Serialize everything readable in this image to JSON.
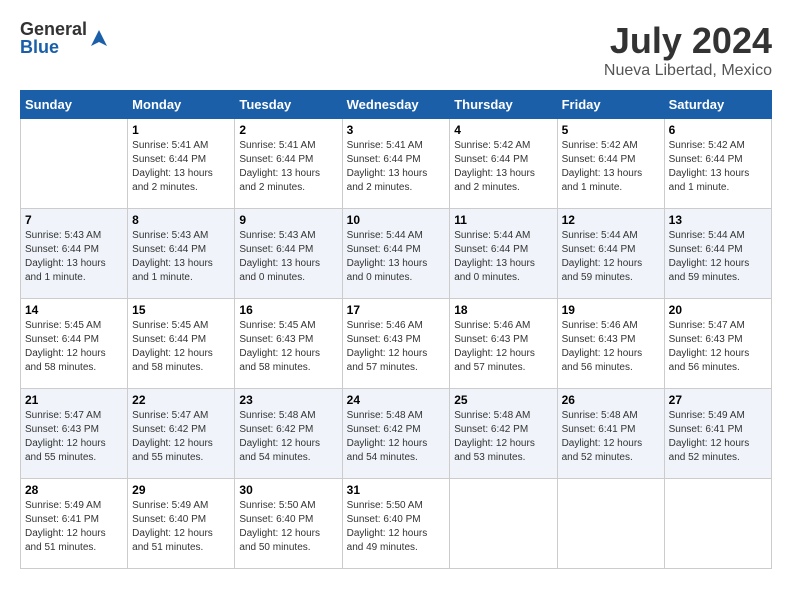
{
  "logo": {
    "general": "General",
    "blue": "Blue"
  },
  "title": "July 2024",
  "subtitle": "Nueva Libertad, Mexico",
  "days_of_week": [
    "Sunday",
    "Monday",
    "Tuesday",
    "Wednesday",
    "Thursday",
    "Friday",
    "Saturday"
  ],
  "weeks": [
    [
      {
        "day": "",
        "sunrise": "",
        "sunset": "",
        "daylight": ""
      },
      {
        "day": "1",
        "sunrise": "Sunrise: 5:41 AM",
        "sunset": "Sunset: 6:44 PM",
        "daylight": "Daylight: 13 hours and 2 minutes."
      },
      {
        "day": "2",
        "sunrise": "Sunrise: 5:41 AM",
        "sunset": "Sunset: 6:44 PM",
        "daylight": "Daylight: 13 hours and 2 minutes."
      },
      {
        "day": "3",
        "sunrise": "Sunrise: 5:41 AM",
        "sunset": "Sunset: 6:44 PM",
        "daylight": "Daylight: 13 hours and 2 minutes."
      },
      {
        "day": "4",
        "sunrise": "Sunrise: 5:42 AM",
        "sunset": "Sunset: 6:44 PM",
        "daylight": "Daylight: 13 hours and 2 minutes."
      },
      {
        "day": "5",
        "sunrise": "Sunrise: 5:42 AM",
        "sunset": "Sunset: 6:44 PM",
        "daylight": "Daylight: 13 hours and 1 minute."
      },
      {
        "day": "6",
        "sunrise": "Sunrise: 5:42 AM",
        "sunset": "Sunset: 6:44 PM",
        "daylight": "Daylight: 13 hours and 1 minute."
      }
    ],
    [
      {
        "day": "7",
        "sunrise": "Sunrise: 5:43 AM",
        "sunset": "Sunset: 6:44 PM",
        "daylight": "Daylight: 13 hours and 1 minute."
      },
      {
        "day": "8",
        "sunrise": "Sunrise: 5:43 AM",
        "sunset": "Sunset: 6:44 PM",
        "daylight": "Daylight: 13 hours and 1 minute."
      },
      {
        "day": "9",
        "sunrise": "Sunrise: 5:43 AM",
        "sunset": "Sunset: 6:44 PM",
        "daylight": "Daylight: 13 hours and 0 minutes."
      },
      {
        "day": "10",
        "sunrise": "Sunrise: 5:44 AM",
        "sunset": "Sunset: 6:44 PM",
        "daylight": "Daylight: 13 hours and 0 minutes."
      },
      {
        "day": "11",
        "sunrise": "Sunrise: 5:44 AM",
        "sunset": "Sunset: 6:44 PM",
        "daylight": "Daylight: 13 hours and 0 minutes."
      },
      {
        "day": "12",
        "sunrise": "Sunrise: 5:44 AM",
        "sunset": "Sunset: 6:44 PM",
        "daylight": "Daylight: 12 hours and 59 minutes."
      },
      {
        "day": "13",
        "sunrise": "Sunrise: 5:44 AM",
        "sunset": "Sunset: 6:44 PM",
        "daylight": "Daylight: 12 hours and 59 minutes."
      }
    ],
    [
      {
        "day": "14",
        "sunrise": "Sunrise: 5:45 AM",
        "sunset": "Sunset: 6:44 PM",
        "daylight": "Daylight: 12 hours and 58 minutes."
      },
      {
        "day": "15",
        "sunrise": "Sunrise: 5:45 AM",
        "sunset": "Sunset: 6:44 PM",
        "daylight": "Daylight: 12 hours and 58 minutes."
      },
      {
        "day": "16",
        "sunrise": "Sunrise: 5:45 AM",
        "sunset": "Sunset: 6:43 PM",
        "daylight": "Daylight: 12 hours and 58 minutes."
      },
      {
        "day": "17",
        "sunrise": "Sunrise: 5:46 AM",
        "sunset": "Sunset: 6:43 PM",
        "daylight": "Daylight: 12 hours and 57 minutes."
      },
      {
        "day": "18",
        "sunrise": "Sunrise: 5:46 AM",
        "sunset": "Sunset: 6:43 PM",
        "daylight": "Daylight: 12 hours and 57 minutes."
      },
      {
        "day": "19",
        "sunrise": "Sunrise: 5:46 AM",
        "sunset": "Sunset: 6:43 PM",
        "daylight": "Daylight: 12 hours and 56 minutes."
      },
      {
        "day": "20",
        "sunrise": "Sunrise: 5:47 AM",
        "sunset": "Sunset: 6:43 PM",
        "daylight": "Daylight: 12 hours and 56 minutes."
      }
    ],
    [
      {
        "day": "21",
        "sunrise": "Sunrise: 5:47 AM",
        "sunset": "Sunset: 6:43 PM",
        "daylight": "Daylight: 12 hours and 55 minutes."
      },
      {
        "day": "22",
        "sunrise": "Sunrise: 5:47 AM",
        "sunset": "Sunset: 6:42 PM",
        "daylight": "Daylight: 12 hours and 55 minutes."
      },
      {
        "day": "23",
        "sunrise": "Sunrise: 5:48 AM",
        "sunset": "Sunset: 6:42 PM",
        "daylight": "Daylight: 12 hours and 54 minutes."
      },
      {
        "day": "24",
        "sunrise": "Sunrise: 5:48 AM",
        "sunset": "Sunset: 6:42 PM",
        "daylight": "Daylight: 12 hours and 54 minutes."
      },
      {
        "day": "25",
        "sunrise": "Sunrise: 5:48 AM",
        "sunset": "Sunset: 6:42 PM",
        "daylight": "Daylight: 12 hours and 53 minutes."
      },
      {
        "day": "26",
        "sunrise": "Sunrise: 5:48 AM",
        "sunset": "Sunset: 6:41 PM",
        "daylight": "Daylight: 12 hours and 52 minutes."
      },
      {
        "day": "27",
        "sunrise": "Sunrise: 5:49 AM",
        "sunset": "Sunset: 6:41 PM",
        "daylight": "Daylight: 12 hours and 52 minutes."
      }
    ],
    [
      {
        "day": "28",
        "sunrise": "Sunrise: 5:49 AM",
        "sunset": "Sunset: 6:41 PM",
        "daylight": "Daylight: 12 hours and 51 minutes."
      },
      {
        "day": "29",
        "sunrise": "Sunrise: 5:49 AM",
        "sunset": "Sunset: 6:40 PM",
        "daylight": "Daylight: 12 hours and 51 minutes."
      },
      {
        "day": "30",
        "sunrise": "Sunrise: 5:50 AM",
        "sunset": "Sunset: 6:40 PM",
        "daylight": "Daylight: 12 hours and 50 minutes."
      },
      {
        "day": "31",
        "sunrise": "Sunrise: 5:50 AM",
        "sunset": "Sunset: 6:40 PM",
        "daylight": "Daylight: 12 hours and 49 minutes."
      },
      {
        "day": "",
        "sunrise": "",
        "sunset": "",
        "daylight": ""
      },
      {
        "day": "",
        "sunrise": "",
        "sunset": "",
        "daylight": ""
      },
      {
        "day": "",
        "sunrise": "",
        "sunset": "",
        "daylight": ""
      }
    ]
  ]
}
